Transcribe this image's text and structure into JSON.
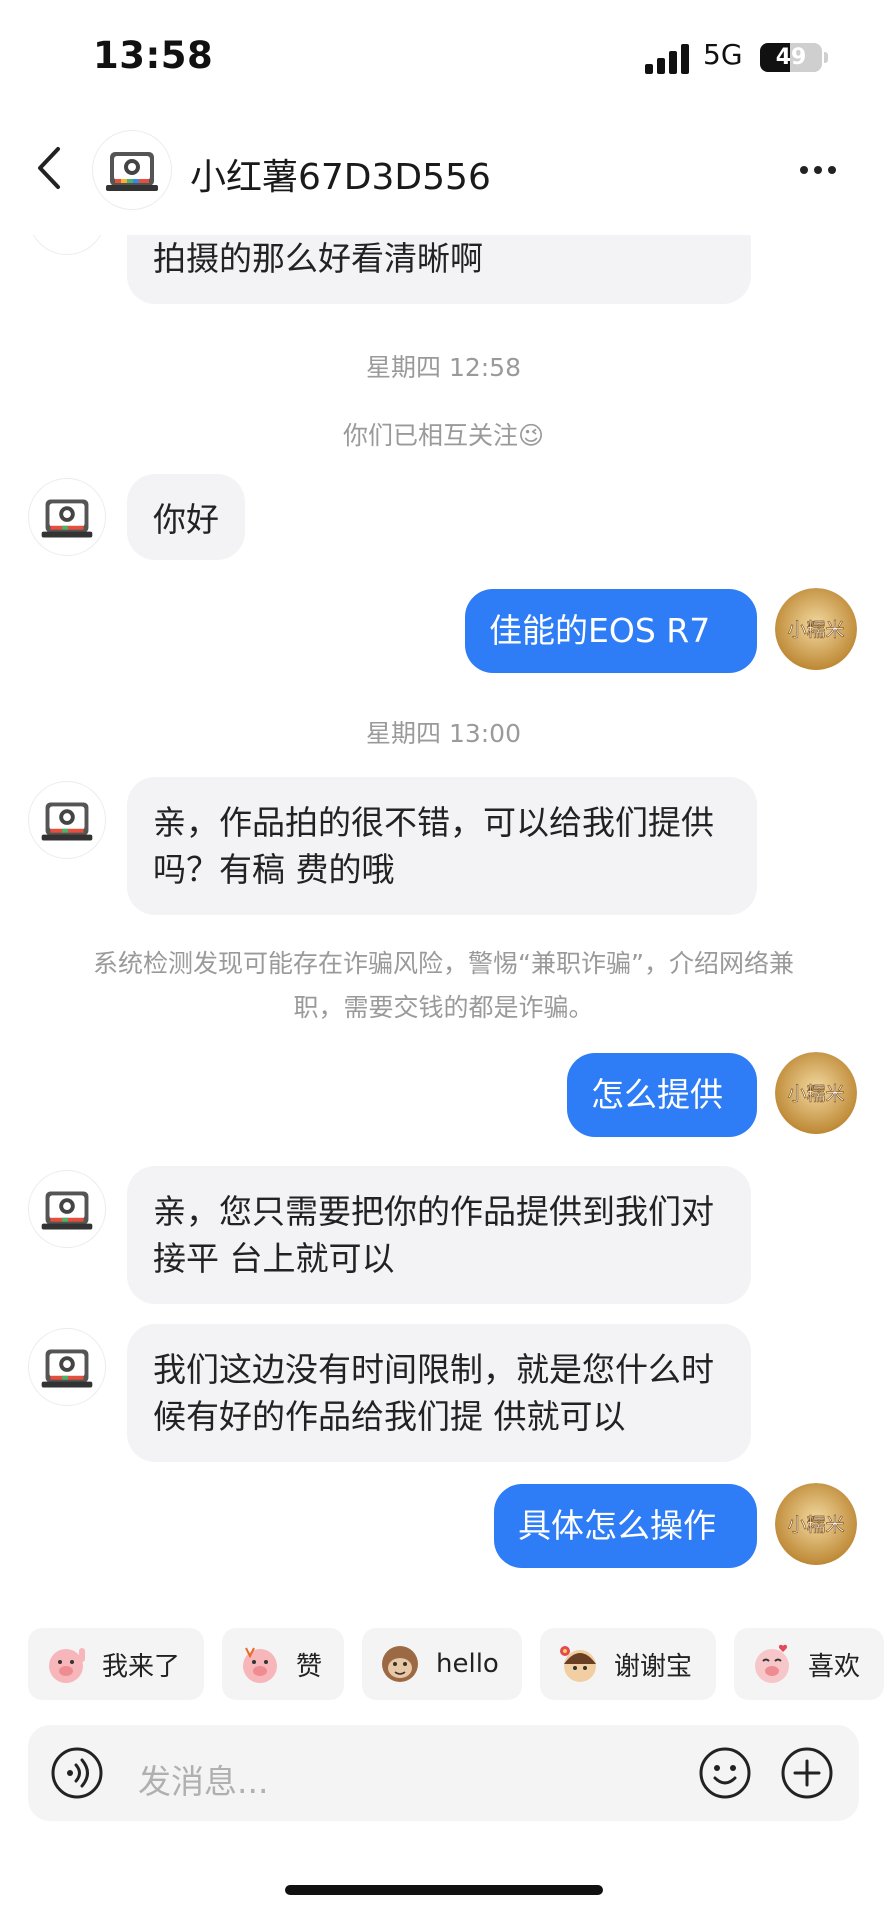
{
  "status_bar": {
    "time": "13:58",
    "network": "5G",
    "battery": "49",
    "battery_level": 0.49
  },
  "header": {
    "title": "小红薯67D3D556",
    "back_icon": "chevron-left-icon",
    "more_icon": "more-icon"
  },
  "messages": {
    "partial_in": "拍摄的那么好看清晰啊",
    "ts1": "星期四 12:58",
    "follow_note": "你们已相互关注😉",
    "in_hello": "你好",
    "out_camera": "佳能的EOS  R7",
    "ts2": "星期四 13:00",
    "in_offer": "亲，作品拍的很不错，可以给我们提供吗？有稿 费的哦",
    "system_warning": "系统检测发现可能存在诈骗风险，警惕“兼职诈骗”，介绍网络兼职，需要交钱的都是诈骗。",
    "out_how": "怎么提供",
    "in_platform": "亲，您只需要把你的作品提供到我们对接平 台上就可以",
    "in_notime": "我们这边没有时间限制，就是您什么时候有好的作品给我们提 供就可以",
    "out_operate": "具体怎么操作"
  },
  "my_avatar_label": "小糯米",
  "quick_replies": [
    "我来了",
    "赞",
    "hello",
    "谢谢宝",
    "喜欢"
  ],
  "input": {
    "placeholder": "发消息..."
  },
  "colors": {
    "accent": "#2e7cf6",
    "incoming_bubble": "#f3f3f5",
    "muted_text": "#9a9a9a"
  }
}
